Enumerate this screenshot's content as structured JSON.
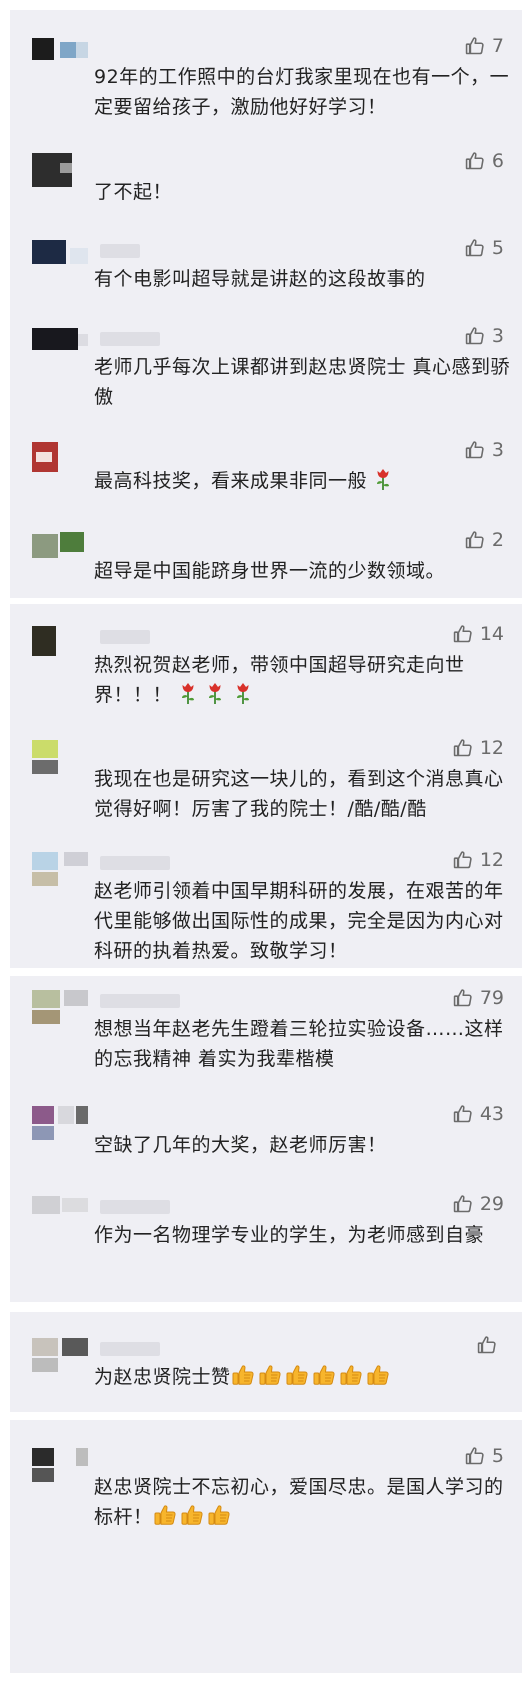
{
  "groups": [
    {
      "comments": [
        {
          "likes": "7",
          "text": "92年的工作照中的台灯我家里现在也有一个，一定要留给孩子，激励他好好学习！",
          "emoji": [],
          "emoji_name": ""
        },
        {
          "likes": "6",
          "text": "了不起！",
          "emoji": [],
          "emoji_name": ""
        },
        {
          "likes": "5",
          "text": "有个电影叫超导就是讲赵的这段故事的",
          "emoji": [],
          "emoji_name": ""
        },
        {
          "likes": "3",
          "text": "老师几乎每次上课都讲到赵忠贤院士 真心感到骄傲",
          "emoji": [],
          "emoji_name": ""
        },
        {
          "likes": "3",
          "text": "最高科技奖，看来成果非同一般",
          "emoji": [
            "rose"
          ],
          "emoji_name": "rose-emoji"
        },
        {
          "likes": "2",
          "text": "超导是中国能跻身世界一流的少数领域。",
          "emoji": [],
          "emoji_name": ""
        }
      ]
    },
    {
      "comments": [
        {
          "likes": "14",
          "text": "热烈祝贺赵老师，带领中国超导研究走向世界！！！",
          "emoji": [
            "rose",
            "rose",
            "rose"
          ],
          "emoji_name": "rose-emoji"
        },
        {
          "likes": "12",
          "text": "我现在也是研究这一块儿的，看到这个消息真心觉得好啊！厉害了我的院士！/酷/酷/酷",
          "emoji": [],
          "emoji_name": ""
        },
        {
          "likes": "12",
          "text": "赵老师引领着中国早期科研的发展，在艰苦的年代里能够做出国际性的成果，完全是因为内心对科研的执着热爱。致敬学习！",
          "emoji": [],
          "emoji_name": ""
        }
      ]
    },
    {
      "comments": [
        {
          "likes": "79",
          "text": "想想当年赵老先生蹬着三轮拉实验设备……这样的忘我精神 着实为我辈楷模",
          "emoji": [],
          "emoji_name": ""
        },
        {
          "likes": "43",
          "text": "空缺了几年的大奖，赵老师厉害！",
          "emoji": [],
          "emoji_name": ""
        },
        {
          "likes": "29",
          "text": "作为一名物理学专业的学生，为老师感到自豪",
          "emoji": [],
          "emoji_name": ""
        }
      ]
    },
    {
      "comments": [
        {
          "likes": "",
          "text": "为赵忠贤院士赞",
          "emoji": [
            "thumb",
            "thumb",
            "thumb",
            "thumb",
            "thumb",
            "thumb"
          ],
          "emoji_name": "thumbs-up-emoji"
        }
      ]
    },
    {
      "comments": [
        {
          "likes": "5",
          "text": "赵忠贤院士不忘初心，爱国尽忠。是国人学习的标杆！",
          "emoji": [
            "thumb",
            "thumb",
            "thumb"
          ],
          "emoji_name": "thumbs-up-emoji"
        }
      ]
    }
  ]
}
